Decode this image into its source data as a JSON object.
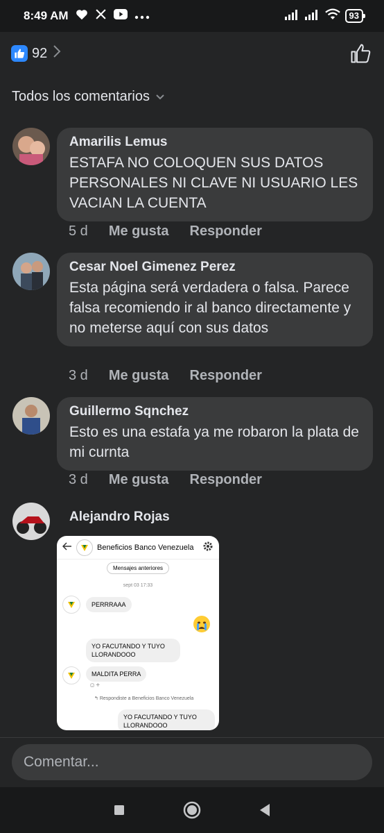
{
  "status": {
    "time": "8:49 AM",
    "icons": [
      "heart-icon",
      "x-icon",
      "youtube-icon",
      "more-icon"
    ],
    "battery": "93"
  },
  "reactions": {
    "count": "92",
    "like_color": "#2d88ff"
  },
  "section_title": "Todos los comentarios",
  "comments": [
    {
      "author": "Amarilis Lemus",
      "text": "ESTAFA NO COLOQUEN SUS DATOS PERSONALES NI CLAVE NI USUARIO LES VACIAN LA CUENTA",
      "time": "5 d",
      "like": "Me gusta",
      "reply": "Responder"
    },
    {
      "author": "Cesar Noel Gimenez Perez",
      "text": "Esta página será verdadera o falsa. Parece falsa recomiendo ir al banco directamente y no meterse aquí con sus datos",
      "time": "3 d",
      "like": "Me gusta",
      "reply": "Responder"
    },
    {
      "author": "Guillermo Sqnchez",
      "text": "Esto es una estafa ya me robaron la plata de mi curnta",
      "time": "3 d",
      "like": "Me gusta",
      "reply": "Responder"
    },
    {
      "author": "Alejandro Rojas"
    }
  ],
  "shot": {
    "header_title": "Beneficios Banco Venezuela",
    "older_messages": "Mensajes anteriores",
    "date": "sept 03 17:33",
    "msg1": "PERRRAAA",
    "msg2": "YO FACUTANDO Y TUYO LLORANDOOO",
    "msg3": "MALDITA PERRA",
    "reply_note": "Respondiste a Beneficios Banco Venezuela",
    "msg4": "YO FACUTANDO Y TUYO LLORANDOOO"
  },
  "input": {
    "placeholder": "Comentar..."
  }
}
